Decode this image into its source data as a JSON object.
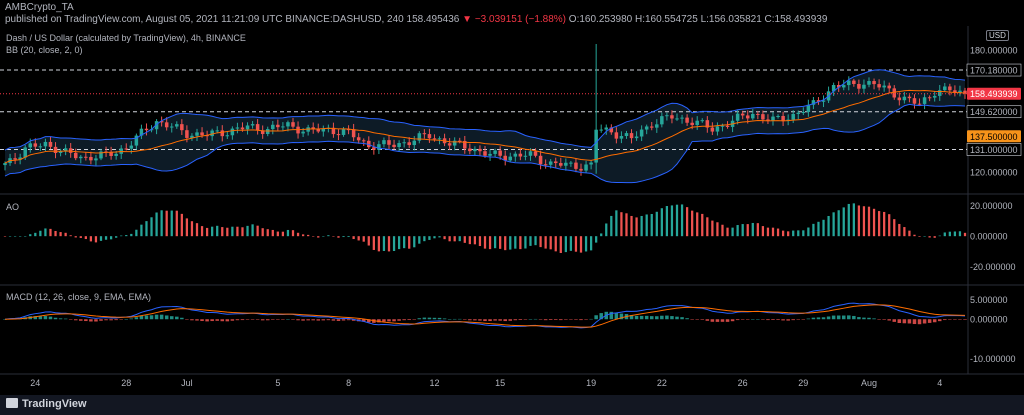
{
  "header": {
    "author": "AMBCrypto_TA",
    "line": "published on TradingView.com, August 05, 2021 11:21:09 UTC",
    "symbol": "BINANCE:DASHUSD, 240",
    "price": "158.495436",
    "change": "▼ −3.039151 (−1.88%)",
    "o": "O:160.253980",
    "h": "H:160.554725",
    "l": "L:156.035821",
    "c": "C:158.493939"
  },
  "legend": {
    "main": "Dash / US Dollar (calculated by TradingView), 4h, BINANCE",
    "bb": "BB (20, close, 2, 0)",
    "ao": "AO",
    "macd": "MACD (12, 26, close, 9, EMA, EMA)"
  },
  "currency": "USD",
  "footer": {
    "brand": "TradingView"
  },
  "colors": {
    "up": "#26a69a",
    "down": "#ef5350",
    "bb": "#2962ff",
    "bbBasis": "#ff6d00",
    "bbFill": "#0d1b26",
    "grid": "#1c1f2b",
    "axisText": "#b2b5be",
    "aoUp": "#26a69a",
    "aoDown": "#ef5350",
    "macdLine": "#2962ff",
    "signal": "#ff6d00",
    "lastPrice": "#f23645",
    "level137": "#f7931a"
  },
  "chart_data": {
    "type": "candlestick",
    "price_axis": {
      "range": [
        111,
        185
      ],
      "ticks": [
        {
          "v": 180,
          "label": "180.000000"
        },
        {
          "v": 170.18,
          "label": "170.180000"
        },
        {
          "v": 158.493939,
          "label": "158.493939"
        },
        {
          "v": 149.62,
          "label": "149.620000"
        },
        {
          "v": 137.5,
          "label": "137.500000"
        },
        {
          "v": 131,
          "label": "131.000000"
        },
        {
          "v": 120,
          "label": "120.000000"
        }
      ]
    },
    "ao_axis": {
      "range": [
        -30,
        25
      ],
      "ticks": [
        {
          "v": 20,
          "label": "20.000000"
        },
        {
          "v": 0,
          "label": "0.000000"
        },
        {
          "v": -20,
          "label": "-20.000000"
        }
      ]
    },
    "macd_axis": {
      "range": [
        -13,
        8
      ],
      "ticks": [
        {
          "v": 5,
          "label": "5.000000"
        },
        {
          "v": 0,
          "label": "0.000000"
        },
        {
          "v": -10,
          "label": "-10.000000"
        }
      ]
    },
    "dashed_levels": [
      170.18,
      149.62,
      131
    ],
    "highlight_levels": [
      {
        "v": 158.493939,
        "label": "158.493939",
        "role": "last"
      },
      {
        "v": 137.5,
        "label": "137.500000",
        "role": "level"
      }
    ],
    "x_axis": {
      "range": [
        0,
        190
      ],
      "ticks": [
        {
          "i": 6,
          "label": "24"
        },
        {
          "i": 24,
          "label": "28"
        },
        {
          "i": 36,
          "label": "Jul"
        },
        {
          "i": 54,
          "label": "5"
        },
        {
          "i": 68,
          "label": "8"
        },
        {
          "i": 85,
          "label": "12"
        },
        {
          "i": 98,
          "label": "15"
        },
        {
          "i": 116,
          "label": "19"
        },
        {
          "i": 130,
          "label": "22"
        },
        {
          "i": 146,
          "label": "26"
        },
        {
          "i": 158,
          "label": "29"
        },
        {
          "i": 171,
          "label": "Aug"
        },
        {
          "i": 185,
          "label": "4"
        }
      ]
    },
    "close_anchors": [
      [
        0,
        124
      ],
      [
        4,
        131
      ],
      [
        8,
        134
      ],
      [
        12,
        129
      ],
      [
        16,
        127
      ],
      [
        20,
        128
      ],
      [
        24,
        132
      ],
      [
        28,
        141
      ],
      [
        30,
        145
      ],
      [
        33,
        142
      ],
      [
        36,
        139
      ],
      [
        40,
        138
      ],
      [
        44,
        140
      ],
      [
        48,
        142
      ],
      [
        52,
        141
      ],
      [
        56,
        143
      ],
      [
        60,
        140
      ],
      [
        64,
        141
      ],
      [
        68,
        139
      ],
      [
        72,
        133
      ],
      [
        76,
        133
      ],
      [
        80,
        135
      ],
      [
        84,
        138
      ],
      [
        88,
        134
      ],
      [
        92,
        132
      ],
      [
        96,
        128
      ],
      [
        100,
        128
      ],
      [
        104,
        128
      ],
      [
        108,
        124
      ],
      [
        112,
        123
      ],
      [
        116,
        123
      ],
      [
        117,
        141
      ],
      [
        120,
        140
      ],
      [
        124,
        136
      ],
      [
        128,
        144
      ],
      [
        132,
        147
      ],
      [
        136,
        145
      ],
      [
        140,
        141
      ],
      [
        144,
        145
      ],
      [
        148,
        149
      ],
      [
        152,
        145
      ],
      [
        156,
        148
      ],
      [
        160,
        153
      ],
      [
        164,
        162
      ],
      [
        168,
        163
      ],
      [
        170,
        164
      ],
      [
        172,
        163
      ],
      [
        175,
        160
      ],
      [
        178,
        156
      ],
      [
        181,
        153
      ],
      [
        184,
        160
      ],
      [
        187,
        160
      ],
      [
        190,
        158.49
      ]
    ],
    "spike": {
      "i": 117,
      "high": 183,
      "low": 119
    },
    "last_price": 158.493939
  }
}
